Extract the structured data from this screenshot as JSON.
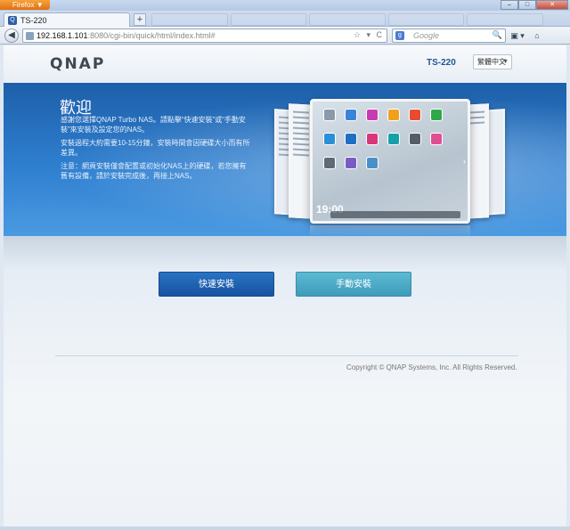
{
  "browser": {
    "menu_label": "Firefox",
    "menu_caret": "▼",
    "window_controls": {
      "minimize": "–",
      "maximize": "□",
      "close": "✕"
    },
    "tab": {
      "favicon": "Q",
      "title": "TS-220"
    },
    "new_tab_label": "+",
    "back_glyph": "◀",
    "url": {
      "host": "192.168.1.101",
      "path": ":8080/cgi-bin/quick/html/index.html#"
    },
    "url_actions": "☆ ▾ C",
    "search": {
      "engine_icon": "g",
      "placeholder": "Google",
      "search_glyph": "🔍"
    },
    "tool_icons": [
      "bookmarks-icon",
      "home-icon"
    ],
    "tool_glyphs": [
      "▣ ▾",
      "⌂"
    ]
  },
  "header": {
    "logo": "QNAP",
    "model": "TS-220",
    "language": {
      "selected": "繁體中文",
      "caret": "▼"
    }
  },
  "banner": {
    "title": "歡迎",
    "paragraphs": [
      "感謝您選擇QNAP Turbo NAS。請點擊“快速安裝”或“手動安裝”來安裝及設定您的NAS。",
      "安裝過程大約需要10-15分鐘，安裝時間會因硬碟大小而有所差異。",
      "注意：網頁安裝僅會配置或初始化NAS上的硬碟，若您擁有舊有設備，請於安裝完成後，再接上NAS。"
    ],
    "tablet_clock": "19:00",
    "tablet_next_arrow": "›"
  },
  "actions": {
    "quick_setup": "快速安裝",
    "manual_setup": "手動安裝"
  },
  "footer": {
    "copyright": "Copyright © QNAP Systems, Inc. All Rights Reserved."
  },
  "colors": {
    "brand_blue": "#1d5fa9",
    "quick_button": "#1753a1",
    "manual_button": "#4aa7c4"
  }
}
